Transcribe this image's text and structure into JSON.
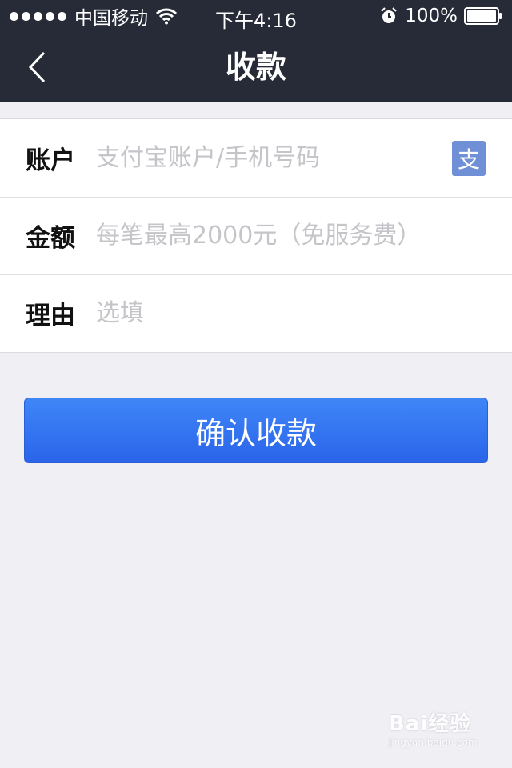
{
  "status_bar": {
    "carrier": "中国移动",
    "time": "下午4:16",
    "battery": "100%",
    "icons": [
      "signal-dots-icon",
      "wifi-icon",
      "alarm-icon",
      "battery-icon"
    ]
  },
  "nav": {
    "title": "收款",
    "back_icon": "chevron-left-icon"
  },
  "form": {
    "account": {
      "label": "账户",
      "placeholder": "支付宝账户/手机号码",
      "contacts_icon_text": "支"
    },
    "amount": {
      "label": "金额",
      "placeholder": "每笔最高2000元（免服务费）"
    },
    "reason": {
      "label": "理由",
      "placeholder": "选填"
    }
  },
  "confirm_button": {
    "label": "确认收款"
  },
  "watermark": {
    "logo": "Bai经验",
    "sub": "jingyan.baidu.com"
  },
  "colors": {
    "header_bg": "#272b37",
    "page_bg": "#efeff4",
    "accent": "#3f86f7",
    "placeholder": "#c5c5c9"
  }
}
